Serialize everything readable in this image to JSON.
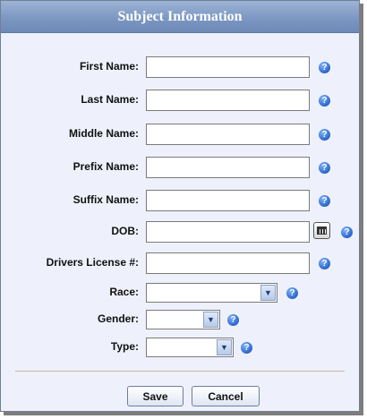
{
  "dialog": {
    "title": "Subject Information"
  },
  "fields": {
    "first_name": {
      "label": "First Name:",
      "value": ""
    },
    "last_name": {
      "label": "Last Name:",
      "value": ""
    },
    "middle_name": {
      "label": "Middle Name:",
      "value": ""
    },
    "prefix_name": {
      "label": "Prefix Name:",
      "value": ""
    },
    "suffix_name": {
      "label": "Suffix Name:",
      "value": ""
    },
    "dob": {
      "label": "DOB:",
      "value": ""
    },
    "drivers_license": {
      "label": "Drivers License #:",
      "value": ""
    },
    "race": {
      "label": "Race:",
      "selected": ""
    },
    "gender": {
      "label": "Gender:",
      "selected": ""
    },
    "type": {
      "label": "Type:",
      "selected": ""
    }
  },
  "help_icon_glyph": "?",
  "buttons": {
    "save": "Save",
    "cancel": "Cancel"
  },
  "colors": {
    "title_bar": "#7c97c2",
    "panel_bg": "#eef1fb",
    "help_icon": "#2b66c8"
  },
  "icons": {
    "help": "help-icon",
    "calendar": "calendar-icon",
    "dropdown": "chevron-down-icon"
  }
}
